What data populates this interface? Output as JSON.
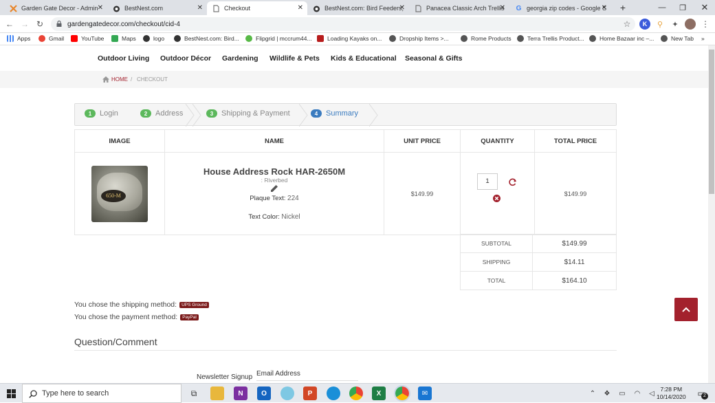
{
  "browser": {
    "tabs": [
      {
        "title": "Garden Gate Decor - Admin",
        "icon_color": "#e8862b"
      },
      {
        "title": "BestNest.com",
        "icon_color": "#333333"
      },
      {
        "title": "Checkout",
        "icon_color": "#777777"
      },
      {
        "title": "BestNest.com: Bird Feeders, ",
        "icon_color": "#333333"
      },
      {
        "title": "Panacea Classic Arch Trellis",
        "icon_color": "#777777"
      },
      {
        "title": "georgia zip codes - Google S",
        "icon_color": "#4285f4"
      }
    ],
    "url": "gardengatedecor.com/checkout/cid-4",
    "bookmarks": [
      {
        "label": "Apps",
        "color": "#4285f4"
      },
      {
        "label": "Gmail",
        "color": "#ea4335"
      },
      {
        "label": "YouTube",
        "color": "#ff0000"
      },
      {
        "label": "Maps",
        "color": "#34a853"
      },
      {
        "label": "logo",
        "color": "#333333"
      },
      {
        "label": "BestNest.com: Bird...",
        "color": "#333333"
      },
      {
        "label": "Flipgrid | mccrum44...",
        "color": "#58b947"
      },
      {
        "label": "Loading Kayaks on...",
        "color": "#b71c1c"
      },
      {
        "label": "Dropship Items >...",
        "color": "#555555"
      },
      {
        "label": "Rome Products",
        "color": "#555555"
      },
      {
        "label": "Terra Trellis Product...",
        "color": "#555555"
      },
      {
        "label": "Home Bazaar inc –...",
        "color": "#555555"
      },
      {
        "label": "New Tab",
        "color": "#555555"
      }
    ],
    "bookmarks_more": "»"
  },
  "nav": {
    "items": [
      "Outdoor Living",
      "Outdoor Décor",
      "Gardening",
      "Wildlife & Pets",
      "Kids & Educational",
      "Seasonal & Gifts"
    ]
  },
  "breadcrumb": {
    "home": "HOME",
    "sep": "/",
    "current": "CHECKOUT"
  },
  "steps": [
    {
      "num": "1",
      "label": "Login"
    },
    {
      "num": "2",
      "label": "Address"
    },
    {
      "num": "3",
      "label": "Shipping & Payment"
    },
    {
      "num": "4",
      "label": "Summary"
    }
  ],
  "cart": {
    "headers": [
      "IMAGE",
      "NAME",
      "UNIT PRICE",
      "QUANTITY",
      "TOTAL PRICE"
    ],
    "item": {
      "name": "House Address Rock HAR-2650M",
      "variant": ": Riverbed",
      "plaque_label": "Plaque Text:",
      "plaque_value": "224",
      "color_label": "Text Color:",
      "color_value": "Nickel",
      "image_text": "650-M",
      "unit_price": "$149.99",
      "quantity": "1",
      "total_price": "$149.99"
    }
  },
  "totals": [
    {
      "label": "SUBTOTAL",
      "value": "$149.99"
    },
    {
      "label": "SHIPPING",
      "value": "$14.11"
    },
    {
      "label": "TOTAL",
      "value": "$164.10"
    }
  ],
  "shipping": {
    "text": "You chose the shipping method:",
    "badge": "UPS Ground"
  },
  "payment": {
    "text": "You chose the payment method:",
    "badge": "PayPal"
  },
  "question_title": "Question/Comment",
  "newsletter": {
    "label": "Newsletter Signup",
    "email_label": "Email Address"
  },
  "taskbar": {
    "search_placeholder": "Type here to search",
    "time": "7:28 PM",
    "date": "10/14/2020",
    "notif_count": "2"
  }
}
